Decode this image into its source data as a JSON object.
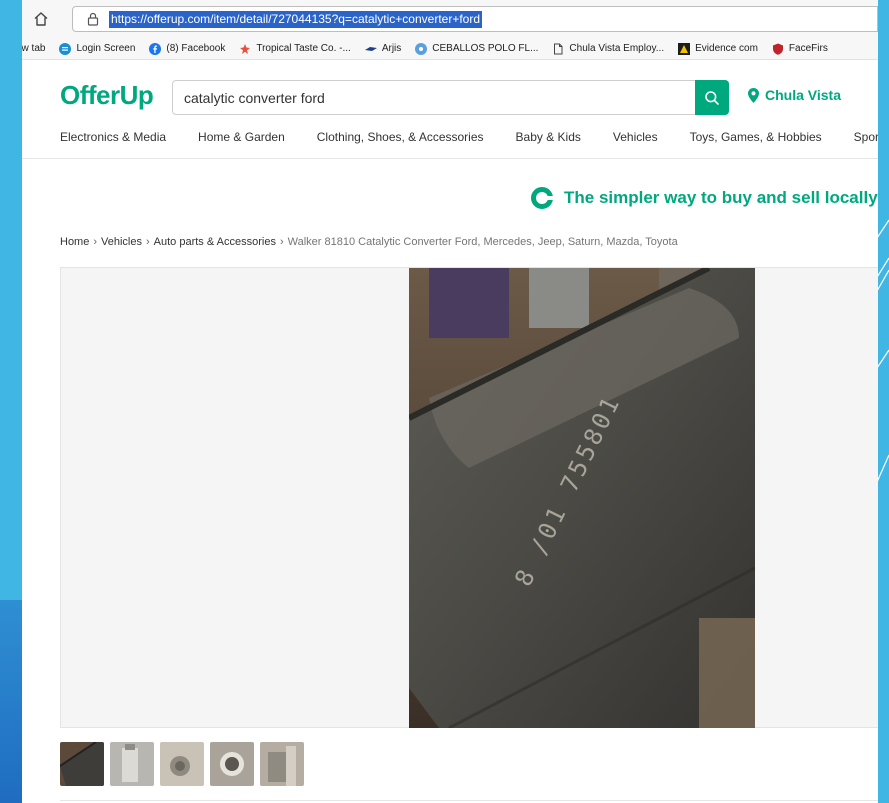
{
  "browser": {
    "url": "https://offerup.com/item/detail/727044135?q=catalytic+converter+ford",
    "bookmarks": [
      {
        "label": "ew tab",
        "icon": "none"
      },
      {
        "label": "Login Screen",
        "icon": "login-screen-icon"
      },
      {
        "label": "(8) Facebook",
        "icon": "facebook-icon"
      },
      {
        "label": "Tropical Taste Co. -...",
        "icon": "tropical-taste-icon"
      },
      {
        "label": "Arjis",
        "icon": "arjis-icon"
      },
      {
        "label": "CEBALLOS POLO FL...",
        "icon": "ceballos-icon"
      },
      {
        "label": "Chula Vista Employ...",
        "icon": "page-icon"
      },
      {
        "label": "Evidence com",
        "icon": "evidence-icon"
      },
      {
        "label": "FaceFirs",
        "icon": "facefirst-icon"
      }
    ]
  },
  "header": {
    "logo": "OfferUp",
    "search_value": "catalytic converter ford",
    "location": "Chula Vista"
  },
  "nav": {
    "categories": [
      "Electronics & Media",
      "Home & Garden",
      "Clothing, Shoes, & Accessories",
      "Baby & Kids",
      "Vehicles",
      "Toys, Games, & Hobbies",
      "Spor"
    ]
  },
  "promo": {
    "text": "The simpler way to buy and sell locally!"
  },
  "breadcrumb": {
    "items": [
      "Home",
      "Vehicles",
      "Auto parts & Accessories"
    ],
    "current": "Walker 81810 Catalytic Converter Ford, Mercedes, Jeep, Saturn, Mazda, Toyota"
  },
  "gallery": {
    "photo_engraving": "8 /01 755801",
    "thumbnails": 5
  },
  "colors": {
    "brand": "#00a87e",
    "url_highlight": "#2b64c9",
    "backdrop": "#3fb6e3"
  }
}
